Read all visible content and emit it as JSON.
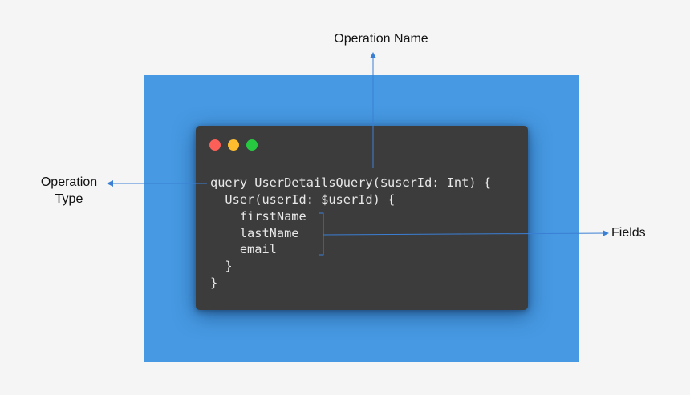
{
  "labels": {
    "operation_name": "Operation Name",
    "operation_type_line1": "Operation",
    "operation_type_line2": "Type",
    "fields": "Fields"
  },
  "code": {
    "lines": [
      "query UserDetailsQuery($userId: Int) {",
      "  User(userId: $userId) {",
      "    firstName",
      "    lastName",
      "    email",
      "  }",
      "}"
    ]
  },
  "window_controls": [
    "close-dot",
    "minimize-dot",
    "maximize-dot"
  ],
  "colors": {
    "background": "#f5f5f5",
    "panel": "#4699e2",
    "editor": "#3c3c3c",
    "code_text": "#e8e8e8",
    "arrow": "#3b7fd4",
    "dot_red": "#fc5f57",
    "dot_yellow": "#fdbd2e",
    "dot_green": "#27c940"
  }
}
